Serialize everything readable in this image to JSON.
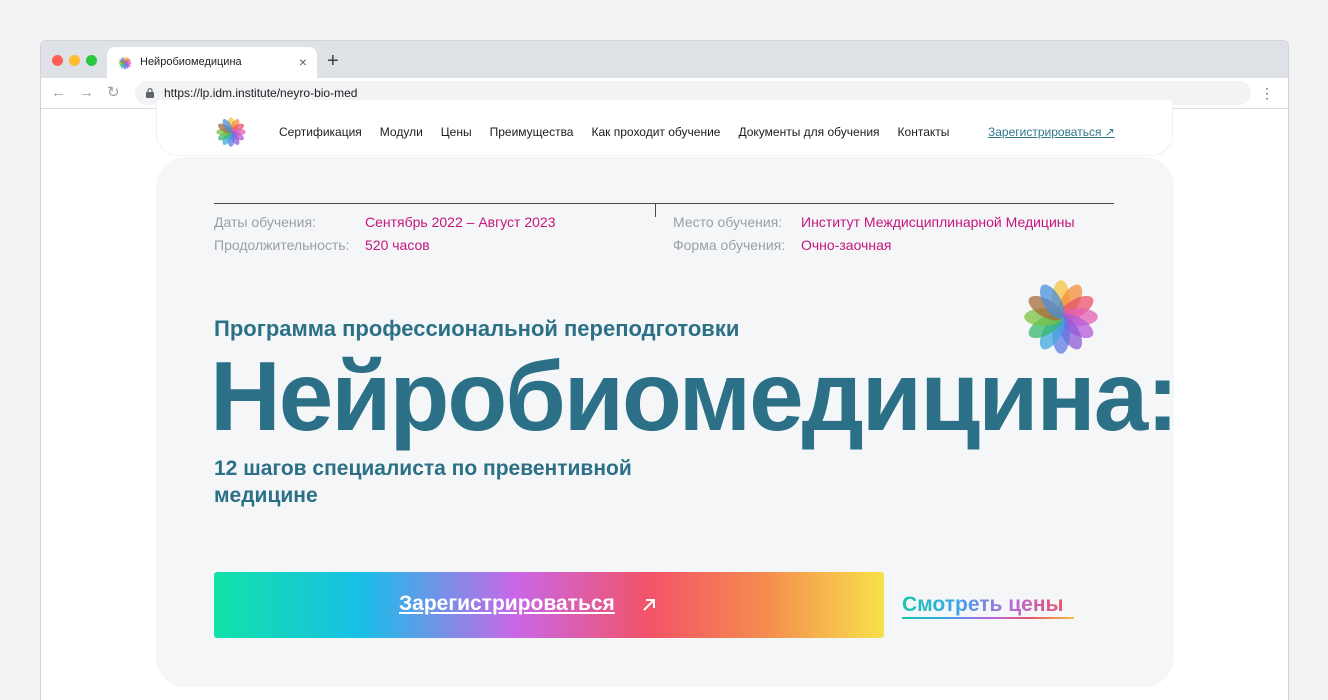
{
  "browser": {
    "tab_title": "Нейробиомедицина",
    "tab_close": "×",
    "new_tab": "+",
    "url": "https://lp.idm.institute/neyro-bio-med",
    "back": "←",
    "forward": "→",
    "reload": "↻",
    "menu": "⋮"
  },
  "nav": {
    "links": [
      "Сертификация",
      "Модули",
      "Цены",
      "Преимущества",
      "Как проходит обучение",
      "Документы для обучения",
      "Контакты"
    ],
    "register": "Зарегистрироваться ↗"
  },
  "info": {
    "dates_label": "Даты обучения:",
    "dates_value": "Сентябрь 2022 – Август 2023",
    "duration_label": "Продолжительность:",
    "duration_value": "520 часов",
    "place_label": "Место обучения:",
    "place_value": "Институт Междисциплинарной Медицины",
    "form_label": "Форма обучения:",
    "form_value": "Очно-заочная"
  },
  "hero": {
    "subtitle": "Программа профессиональной переподготовки",
    "title": "Нейробиомедицина:",
    "tagline": "12 шагов специалиста по превентивной медицине",
    "cta_label": "Зарегистрироваться",
    "prices_link": "Смотреть цены"
  },
  "colors": {
    "brand_teal": "#2b7086",
    "accent_magenta": "#c4167f",
    "label_gray": "#9a9ea8"
  },
  "icons": {
    "logo": "flower-logo-icon",
    "cta_arrow": "arrow-up-right-icon",
    "lock": "lock-icon"
  }
}
